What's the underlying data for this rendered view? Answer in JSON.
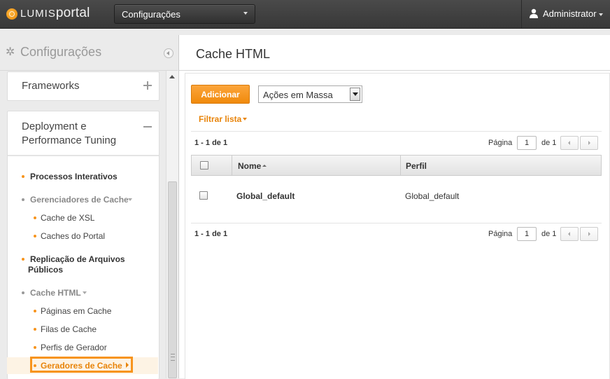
{
  "topbar": {
    "logo_brand": "LUMIS",
    "logo_product": "portal",
    "site_selector": "Configurações",
    "user_name": "Administrator"
  },
  "sidebar": {
    "title": "Configurações",
    "panels": [
      {
        "label": "Frameworks",
        "state": "collapsed"
      },
      {
        "label": "Deployment e Performance Tuning",
        "state": "expanded"
      }
    ],
    "nav": [
      {
        "label": "Processos Interativos",
        "level": 1
      },
      {
        "label": "Gerenciadores de Cache",
        "level": 1,
        "expandable": true
      },
      {
        "label": "Cache de XSL",
        "level": 2
      },
      {
        "label": "Caches do Portal",
        "level": 2
      },
      {
        "label": "Replicação de Arquivos Públicos",
        "level": 1
      },
      {
        "label": "Cache HTML",
        "level": 1,
        "expandable": true
      },
      {
        "label": "Páginas em Cache",
        "level": 2
      },
      {
        "label": "Filas de Cache",
        "level": 2
      },
      {
        "label": "Perfis de Gerador",
        "level": 2
      },
      {
        "label": "Geradores de Cache",
        "level": 2,
        "active": true
      }
    ]
  },
  "main": {
    "title": "Cache HTML",
    "add_button": "Adicionar",
    "bulk_actions": "Ações em Massa",
    "filter_link": "Filtrar lista",
    "pager_top": {
      "range": "1 - 1 de 1",
      "page_label": "Página",
      "page": "1",
      "of_label": "de 1"
    },
    "pager_bottom": {
      "range": "1 - 1 de 1",
      "page_label": "Página",
      "page": "1",
      "of_label": "de 1"
    },
    "table": {
      "columns": [
        "Nome",
        "Perfil"
      ],
      "rows": [
        {
          "nome": "Global_default",
          "perfil": "Global_default"
        }
      ]
    }
  },
  "colors": {
    "accent": "#f7941d",
    "topbar": "#3d3d3d",
    "link": "#e8840a"
  }
}
